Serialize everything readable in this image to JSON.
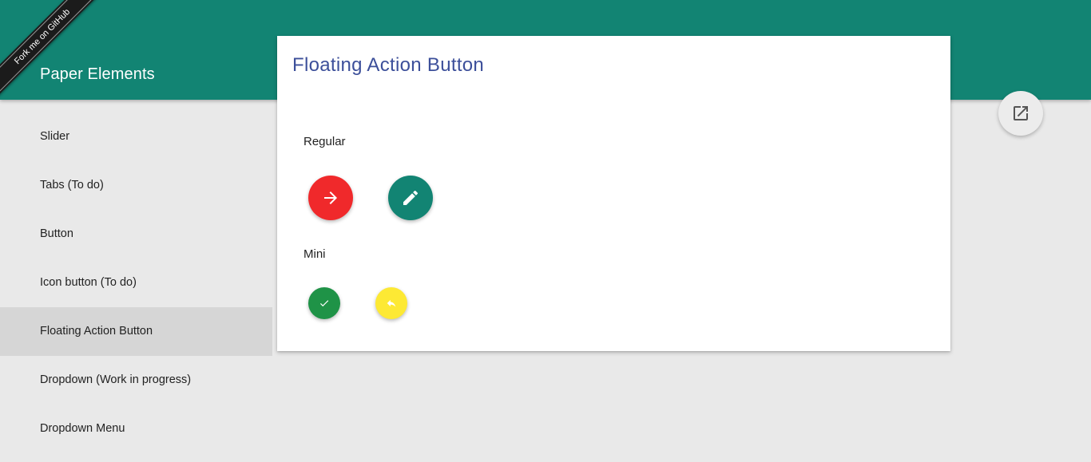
{
  "header": {
    "title": "Paper Elements",
    "ribbon_text": "Fork me on GitHub",
    "color": "#128473"
  },
  "sidebar": {
    "items": [
      {
        "label": "Slider"
      },
      {
        "label": "Tabs (To do)"
      },
      {
        "label": "Button"
      },
      {
        "label": "Icon button (To do)"
      },
      {
        "label": "Floating Action Button",
        "active": true
      },
      {
        "label": "Dropdown (Work in progress)"
      },
      {
        "label": "Dropdown Menu"
      }
    ]
  },
  "card": {
    "title": "Floating Action Button",
    "sections": {
      "regular": {
        "label": "Regular",
        "buttons": [
          {
            "icon": "arrow-forward-icon",
            "color": "#f0292b"
          },
          {
            "icon": "pencil-icon",
            "color": "#128473"
          }
        ]
      },
      "mini": {
        "label": "Mini",
        "buttons": [
          {
            "icon": "check-icon",
            "color": "#1f9347"
          },
          {
            "icon": "reply-icon",
            "color": "#fde934"
          }
        ]
      }
    }
  },
  "actions": {
    "open_in_new_icon": "open-in-new-icon"
  }
}
